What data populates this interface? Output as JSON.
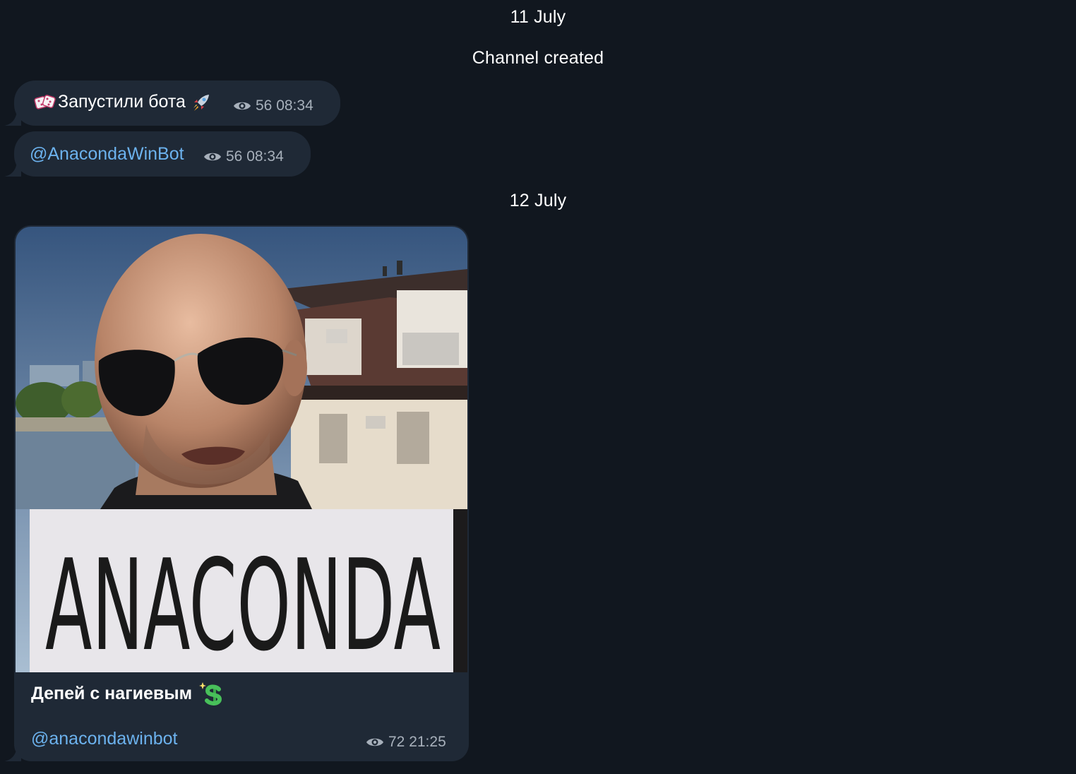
{
  "dates": {
    "first": "11 July",
    "second": "12 July"
  },
  "service_message": "Channel created",
  "messages": [
    {
      "text": "Запустили бота",
      "views": "56",
      "time": "08:34",
      "emoji_start": "dice-icon",
      "emoji_end": "rocket-icon"
    },
    {
      "text": "@AnacondaWinBot",
      "views": "56",
      "time": "08:34"
    },
    {
      "photo_text": "ANACONDA",
      "caption": "Депей с нагиевым",
      "caption_emoji": "dollar-icon",
      "link": "@anacondawinbot",
      "views": "72",
      "time": "21:25"
    }
  ],
  "colors": {
    "background": "#11171f",
    "bubble": "#1f2936",
    "link": "#6cb2ee",
    "meta": "#a7b0bb"
  }
}
